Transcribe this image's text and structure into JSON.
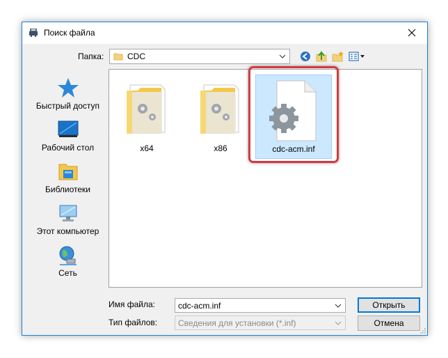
{
  "window": {
    "title": "Поиск файла"
  },
  "lookin": {
    "label": "Папка:",
    "value": "CDC"
  },
  "toolbar_icons": [
    "back-icon",
    "up-folder-icon",
    "new-folder-icon",
    "view-menu-icon"
  ],
  "places": [
    {
      "label": "Быстрый доступ",
      "icon": "quick-access-star-icon"
    },
    {
      "label": "Рабочий стол",
      "icon": "desktop-icon"
    },
    {
      "label": "Библиотеки",
      "icon": "libraries-icon"
    },
    {
      "label": "Этот компьютер",
      "icon": "this-pc-icon"
    },
    {
      "label": "Сеть",
      "icon": "network-icon"
    }
  ],
  "files": [
    {
      "name": "x64",
      "type": "folder"
    },
    {
      "name": "x86",
      "type": "folder"
    },
    {
      "name": "cdc-acm.inf",
      "type": "inf-file",
      "selected": true
    }
  ],
  "filename": {
    "label": "Имя файла:",
    "value": "cdc-acm.inf"
  },
  "filetype": {
    "label": "Тип файлов:",
    "value": "Сведения для установки (*.inf)"
  },
  "buttons": {
    "open": "Открыть",
    "cancel": "Отмена"
  },
  "colors": {
    "accent": "#0078d7",
    "highlight": "#d23a42",
    "selection": "#cce8ff"
  }
}
